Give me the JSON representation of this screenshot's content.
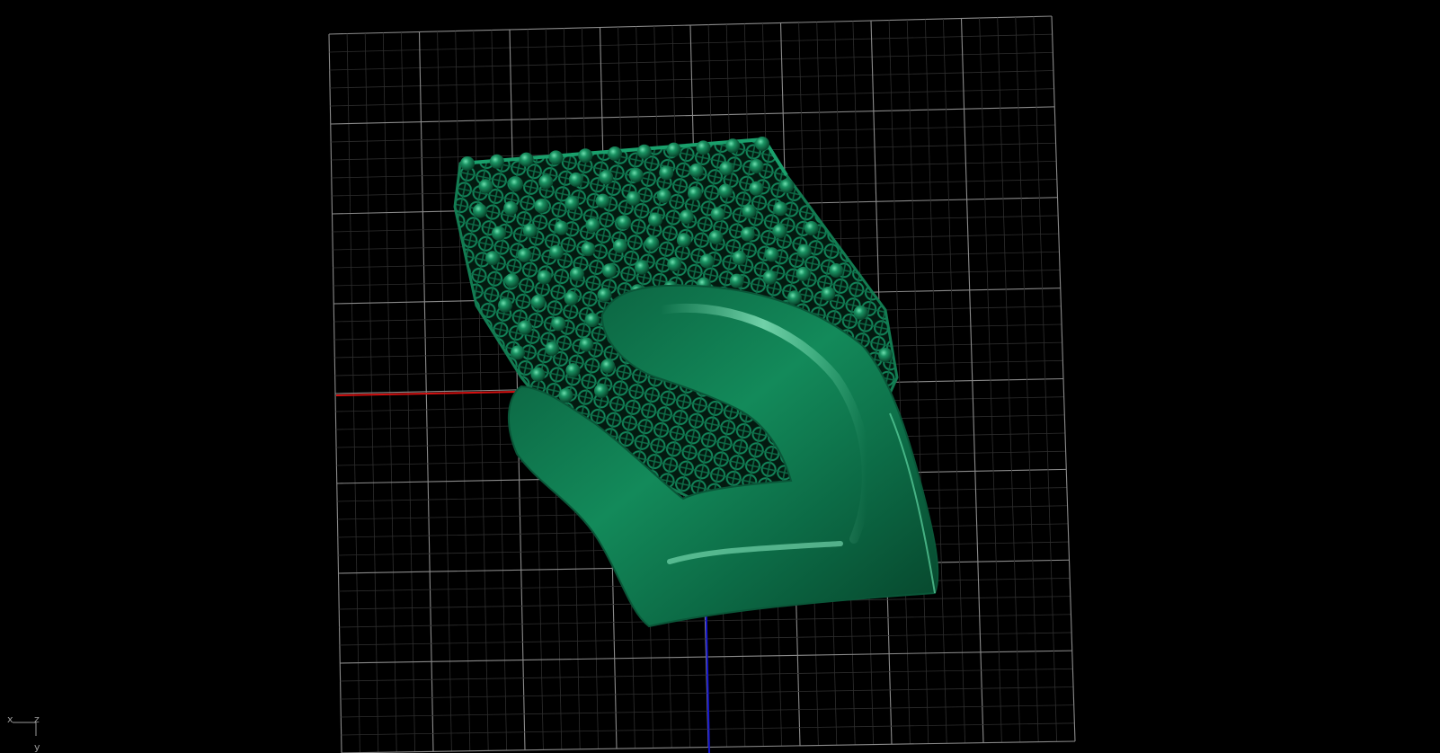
{
  "viewport": {
    "background": "#000000",
    "grid_color": "#8a8a8a",
    "minor_grid_color": "#3a3a3a",
    "x_axis_color": "#d41010",
    "y_axis_color": "#1515d0",
    "model_color": "#0f7a52"
  },
  "gizmo": {
    "x_label": "x",
    "z_label": "z",
    "y_label": "y"
  }
}
